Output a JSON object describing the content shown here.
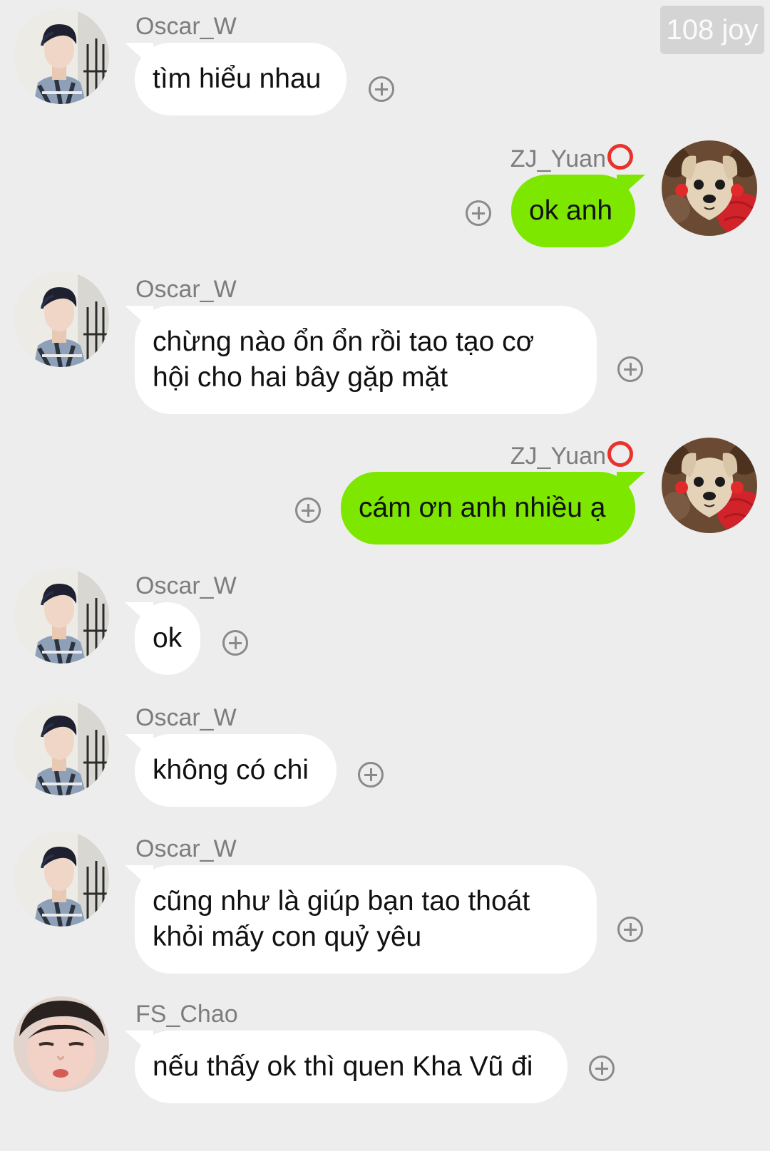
{
  "badge": "108 joy",
  "icons": {
    "add": "plus-circle-icon"
  },
  "messages": [
    {
      "sender": "Oscar_W",
      "text": "tìm hiểu nhau"
    },
    {
      "sender": "ZJ_Yuan",
      "text": "ok anh"
    },
    {
      "sender": "Oscar_W",
      "text": "chừng nào ổn ổn rồi tao tạo cơ hội cho hai bây gặp mặt"
    },
    {
      "sender": "ZJ_Yuan",
      "text": "cám ơn anh nhiều ạ"
    },
    {
      "sender": "Oscar_W",
      "text": "ok"
    },
    {
      "sender": "Oscar_W",
      "text": "không có chi"
    },
    {
      "sender": "Oscar_W",
      "text": "cũng như là giúp bạn tao thoát khỏi mấy con quỷ yêu"
    },
    {
      "sender": "FS_Chao",
      "text": "nếu thấy ok thì quen Kha Vũ đi"
    }
  ],
  "colors": {
    "background": "#ededed",
    "incoming_bubble": "#ffffff",
    "outgoing_bubble": "#7de700",
    "name_text": "#7d7d7d",
    "badge_bg": "#d4d4d4",
    "status_ring": "#e8322c"
  }
}
